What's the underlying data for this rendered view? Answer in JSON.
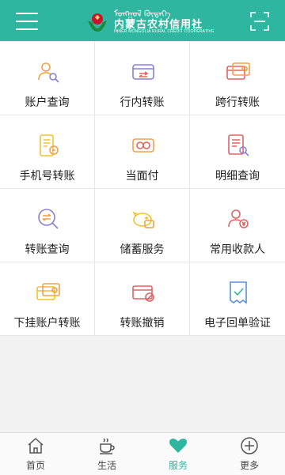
{
  "header": {
    "logo_script": "ᠮᠣᠩᠭᠣᠯ ᠬᠥᠳᠡᠭᠡ",
    "logo_cn": "内蒙古农村信用社",
    "logo_en": "INNER MONGOLIA RURAL CREDIT COOPERATIVE"
  },
  "services": [
    {
      "label": "账户查询",
      "icon": "account-query-icon"
    },
    {
      "label": "行内转账",
      "icon": "intrabank-transfer-icon"
    },
    {
      "label": "跨行转账",
      "icon": "interbank-transfer-icon"
    },
    {
      "label": "手机号转账",
      "icon": "phone-transfer-icon"
    },
    {
      "label": "当面付",
      "icon": "face-pay-icon"
    },
    {
      "label": "明细查询",
      "icon": "detail-query-icon"
    },
    {
      "label": "转账查询",
      "icon": "transfer-query-icon"
    },
    {
      "label": "储蓄服务",
      "icon": "savings-icon"
    },
    {
      "label": "常用收款人",
      "icon": "payee-icon"
    },
    {
      "label": "下挂账户转账",
      "icon": "linked-account-transfer-icon"
    },
    {
      "label": "转账撤销",
      "icon": "transfer-cancel-icon"
    },
    {
      "label": "电子回单验证",
      "icon": "receipt-verify-icon"
    }
  ],
  "tabbar": [
    {
      "label": "首页",
      "icon": "home-icon"
    },
    {
      "label": "生活",
      "icon": "cup-icon"
    },
    {
      "label": "服务",
      "icon": "heart-icon",
      "active": true
    },
    {
      "label": "更多",
      "icon": "plus-circle-icon"
    }
  ],
  "colors": {
    "brand": "#2fb6a0",
    "orange": "#f0a14a",
    "purple": "#8b7fd1",
    "red": "#e06464",
    "yellow": "#f1c232"
  }
}
